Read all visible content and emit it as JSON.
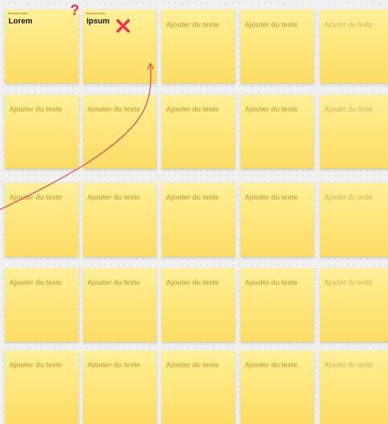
{
  "board": {
    "notes": [
      {
        "author": "Bernardo Gomes",
        "text": "Lorem"
      },
      {
        "author": "Bernardo Gomes",
        "text": "Ipsum"
      },
      {
        "text": "Ajouter du texte"
      },
      {
        "text": "Ajouter du texte"
      },
      {
        "text": "Ajouter du texte"
      },
      {
        "text": "Ajouter du texte"
      },
      {
        "text": "Ajouter du texte"
      },
      {
        "text": "Ajouter du texte"
      },
      {
        "text": "Ajouter du texte"
      },
      {
        "text": "Ajouter du texte"
      },
      {
        "text": "Ajouter du texte"
      },
      {
        "text": "Ajouter du texte"
      },
      {
        "text": "Ajouter du texte"
      },
      {
        "text": "Ajouter du texte"
      },
      {
        "text": "Ajouter du texte"
      },
      {
        "text": "Ajouter du texte"
      },
      {
        "text": "Ajouter du texte"
      },
      {
        "text": "Ajouter du texte"
      },
      {
        "text": "Ajouter du texte"
      },
      {
        "text": "Ajouter du texte"
      },
      {
        "text": "Ajouter du texte"
      },
      {
        "text": "Ajouter du texte"
      },
      {
        "text": "Ajouter du texte"
      },
      {
        "text": "Ajouter du texte"
      },
      {
        "text": "Ajouter du texte"
      }
    ]
  },
  "annotations": {
    "question_mark": "?",
    "cross_icon": "cross-icon",
    "arrow": "curved-arrow-connector"
  },
  "colors": {
    "note_fill": "#ffe77d",
    "annotation_red": "#e8344f",
    "placeholder_text": "#c9ae4a"
  }
}
